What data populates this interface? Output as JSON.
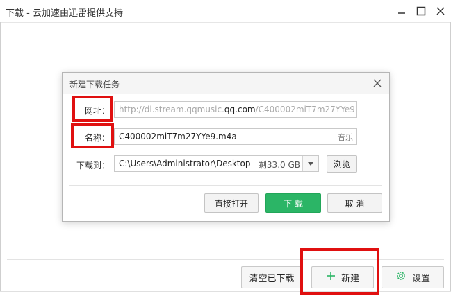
{
  "window": {
    "title": "下载 - 云加速由迅雷提供支持",
    "minimize_label": "",
    "colors": {
      "accent_green": "#2bb566",
      "highlight_red": "#e01010"
    }
  },
  "dialog": {
    "title": "新建下载任务",
    "url_label": "网址：",
    "url_prefix": "http://dl.stream.qqmusic.",
    "url_domain": "qq.com",
    "url_suffix": "/C400002miT7m27YYe9.m",
    "name_label": "名称：",
    "name_value": "C400002miT7m27YYe9.m4a",
    "name_type": "音乐",
    "path_label": "下载到：",
    "path_value": "C:\\Users\\Administrator\\Desktop",
    "space_left": "剩33.0 GB",
    "browse_button": "浏览",
    "open_direct_button": "直接打开",
    "download_button": "下 载",
    "cancel_button": "取 消"
  },
  "bottom_bar": {
    "clear_button": "清空已下载",
    "new_button": "新建",
    "settings_button": "设置"
  }
}
